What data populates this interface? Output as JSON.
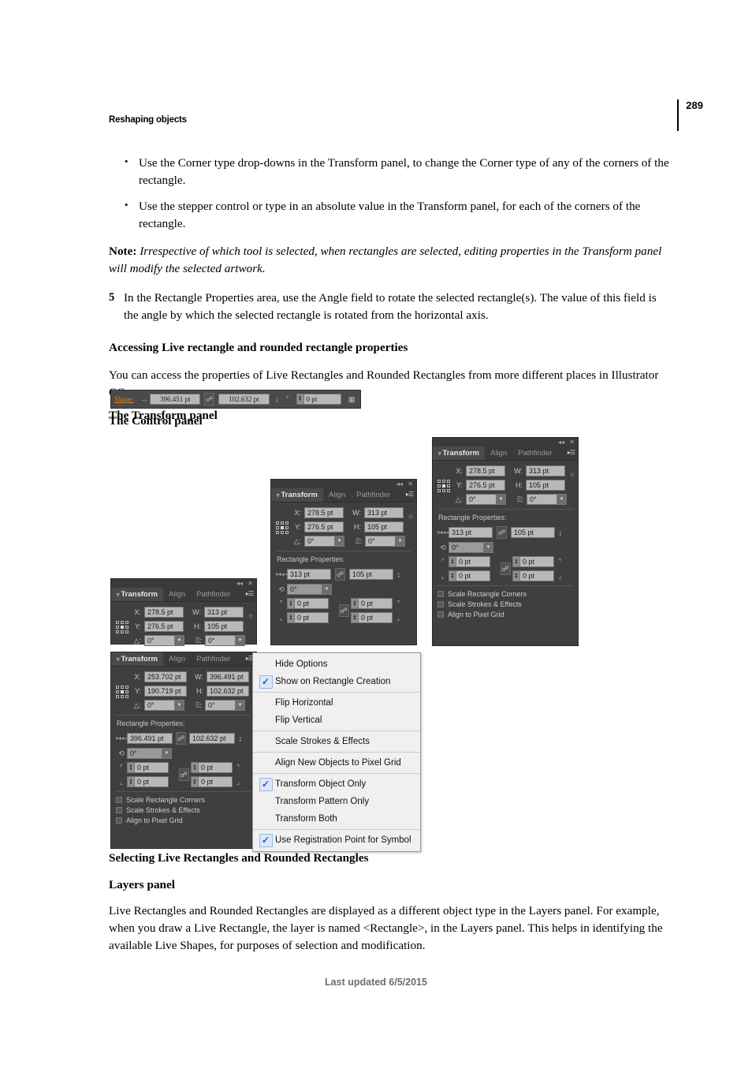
{
  "page": {
    "running_head": "Reshaping objects",
    "page_number": "289",
    "footer": "Last updated 6/5/2015"
  },
  "content": {
    "bullets": [
      "Use the Corner type drop-downs in the Transform panel, to change the Corner type of any of the corners of the rectangle.",
      "Use the stepper control or type in an absolute value in the Transform panel, for each of the corners of the rectangle."
    ],
    "note_label": "Note:",
    "note_text": " Irrespective of which tool is selected, when rectangles are selected, editing properties in the Transform panel will modify the selected artwork.",
    "step_number": "5",
    "step_text": "In the Rectangle Properties area, use the Angle field to rotate the selected rectangle(s). The value of this field is the angle by which the selected rectangle is rotated from the horizontal axis.",
    "heading_accessing": "Accessing Live rectangle and rounded rectangle properties",
    "para_access": "You can access the properties of Live Rectangles and Rounded Rectangles from more different places in Illustrator CC.",
    "heading_control_panel": "The Control panel",
    "heading_transform_panel": "The Transform panel",
    "heading_selecting": "Selecting Live Rectangles and Rounded Rectangles",
    "heading_layers_panel": "Layers panel",
    "para_layers": "Live Rectangles and Rounded Rectangles are displayed as a different object type in the Layers panel. For example, when you draw a Live Rectangle, the layer is named <Rectangle>, in the Layers panel. This helps in identifying the available Live Shapes, for purposes of selection and modification."
  },
  "control_panel": {
    "shape_label": "Shape:",
    "width_value": "396.451 pt",
    "height_value": "102.632 pt",
    "corner_value": "0 pt"
  },
  "panel_tabs": {
    "transform": "Transform",
    "align": "Align",
    "pathfinder": "Pathfinder"
  },
  "panel_labels": {
    "x": "X:",
    "y": "Y:",
    "w": "W:",
    "h": "H:",
    "rect_properties": "Rectangle Properties:",
    "scale_rect_corners": "Scale Rectangle Corners",
    "scale_strokes": "Scale Strokes & Effects",
    "align_pixel_grid": "Align to Pixel Grid"
  },
  "panel_a": {
    "x": "278.5 pt",
    "y": "276.5 pt",
    "w": "313 pt",
    "h": "105 pt",
    "shear": "0°",
    "rotate": "0°"
  },
  "panel_b": {
    "x": "278.5 pt",
    "y": "276.5 pt",
    "w": "313 pt",
    "h": "105 pt",
    "shear": "0°",
    "rotate": "0°",
    "rp_width": "313 pt",
    "rp_height": "105 pt",
    "rp_angle": "0°",
    "corner_tl": "0 pt",
    "corner_tr": "0 pt",
    "corner_bl": "0 pt",
    "corner_br": "0 pt"
  },
  "panel_c": {
    "x": "278.5 pt",
    "y": "276.5 pt",
    "w": "313 pt",
    "h": "105 pt",
    "shear": "0°",
    "rotate": "0°",
    "rp_width": "313 pt",
    "rp_height": "105 pt",
    "rp_angle": "0°",
    "corner_tl": "0 pt",
    "corner_tr": "0 pt",
    "corner_bl": "0 pt",
    "corner_br": "0 pt"
  },
  "panel_d": {
    "x": "253.702 pt",
    "y": "190.719 pt",
    "w": "396.491 pt",
    "h": "102.632 pt",
    "shear": "0°",
    "rotate": "0°",
    "rp_width": "396.491 pt",
    "rp_height": "102.632 pt",
    "rp_angle": "0°",
    "corner_tl": "0 pt",
    "corner_tr": "0 pt",
    "corner_bl": "0 pt",
    "corner_br": "0 pt"
  },
  "flyout_menu": {
    "items": [
      {
        "label": "Hide Options",
        "checked": false
      },
      {
        "label": "Show on Rectangle Creation",
        "checked": true
      },
      {
        "label": "Flip Horizontal",
        "checked": false
      },
      {
        "label": "Flip Vertical",
        "checked": false
      },
      {
        "label": "Scale Strokes & Effects",
        "checked": false
      },
      {
        "label": "Align New Objects to Pixel Grid",
        "checked": false
      },
      {
        "label": "Transform Object Only",
        "checked": true
      },
      {
        "label": "Transform Pattern Only",
        "checked": false
      },
      {
        "label": "Transform Both",
        "checked": false
      },
      {
        "label": "Use Registration Point for Symbol",
        "checked": true
      }
    ]
  },
  "colors": {
    "panel_bg": "#3f3f3f",
    "field_bg": "#b8b8b8",
    "accent_orange": "#e8820c",
    "menu_check": "#2255cc"
  }
}
